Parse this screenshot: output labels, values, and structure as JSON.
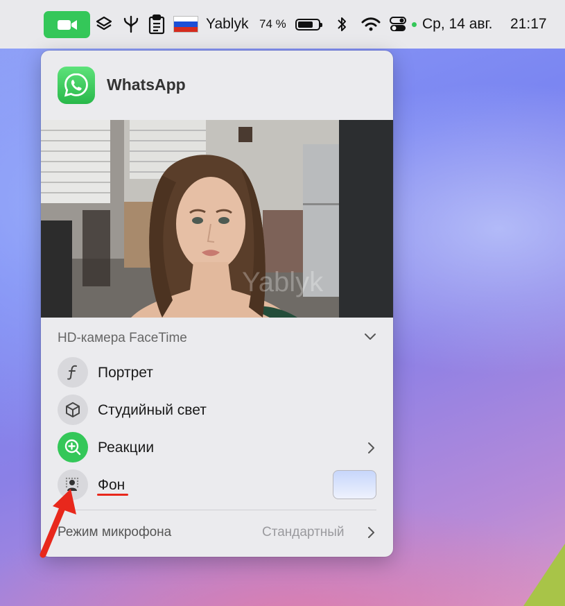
{
  "menubar": {
    "keyboard_layout": "Yablyk",
    "battery_percent": "74 %",
    "battery_level": 0.74,
    "datetime": "Ср, 14 авг.",
    "time": "21:17",
    "icons": [
      "facetime-camera-icon",
      "layers-icon",
      "fork-icon",
      "clipboard-icon",
      "russian-flag-icon",
      "battery-icon",
      "bluetooth-icon",
      "wifi-icon",
      "control-center-icon"
    ],
    "accent": "#34c759"
  },
  "popover": {
    "app_name": "WhatsApp",
    "watermark": "Yablyk",
    "camera_name": "HD-камера FaceTime",
    "options": [
      {
        "label": "Портрет",
        "icon": "portrait-f-icon"
      },
      {
        "label": "Студийный свет",
        "icon": "cube-icon"
      },
      {
        "label": "Реакции",
        "icon": "reactions-plus-icon"
      },
      {
        "label": "Фон",
        "icon": "background-person-icon"
      }
    ],
    "mic_mode_label": "Режим микрофона",
    "mic_mode_value": "Стандартный",
    "reactions_accent": "#34c759"
  }
}
